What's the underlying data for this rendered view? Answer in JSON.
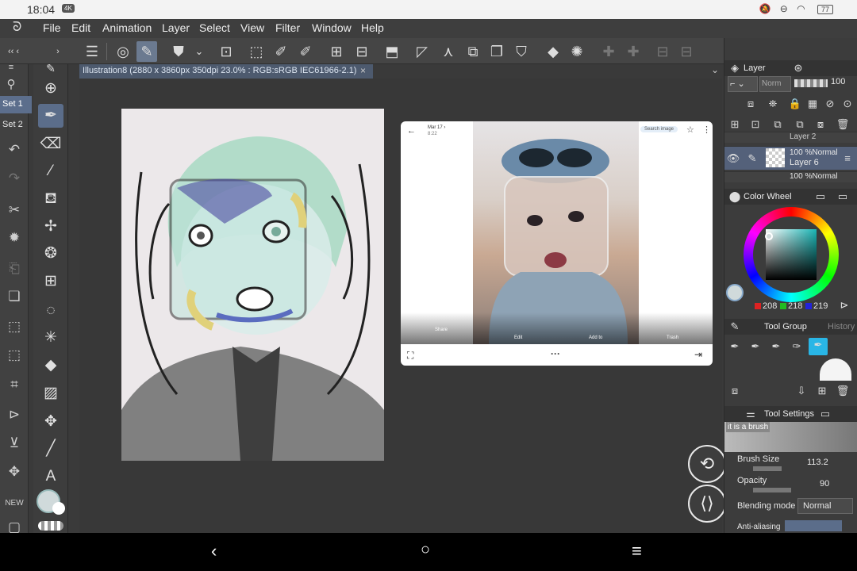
{
  "status_bar": {
    "time": "18:04",
    "badge": "4K",
    "battery": "77"
  },
  "menu": [
    "File",
    "Edit",
    "Animation",
    "Layer",
    "Select",
    "View",
    "Filter",
    "Window",
    "Help"
  ],
  "sets": [
    "Set 1",
    "Set 2"
  ],
  "document": {
    "tab_title": "Illustration8 (2880 x 3860px 350dpi 23.0% : RGB:sRGB IEC61966-2.1)",
    "close": "×"
  },
  "reference": {
    "header_title": "Mar 17 ›",
    "header_sub": "8:22",
    "search_label": "Search image",
    "actions": [
      "Share",
      "Edit",
      "Add to",
      "Trash"
    ],
    "more": "···"
  },
  "layer_panel": {
    "title": "Layer",
    "blend_value": "Norm",
    "opacity": "100",
    "layers": [
      {
        "name": "Layer 2",
        "mode": ""
      },
      {
        "name": "Layer 6",
        "mode": "100 %Normal"
      },
      {
        "name": "",
        "mode": "100 %Normal"
      }
    ]
  },
  "color_wheel": {
    "title": "Color Wheel",
    "r": "208",
    "g": "218",
    "b": "219",
    "current_color": "#d0dadb"
  },
  "tool_group": {
    "title": "Tool Group",
    "history": "History"
  },
  "tool_settings": {
    "title": "Tool Settings",
    "brush_name": "it is a brush",
    "brush_size_label": "Brush Size",
    "brush_size_value": "113.2",
    "opacity_label": "Opacity",
    "opacity_value": "90",
    "blending_label": "Blending mode",
    "blending_value": "Normal",
    "antialias_label": "Anti-aliasing"
  },
  "colors": {
    "accent": "#5b6d8a",
    "panel_bg": "#3c3c3c",
    "canvas_bg": "#383838"
  }
}
